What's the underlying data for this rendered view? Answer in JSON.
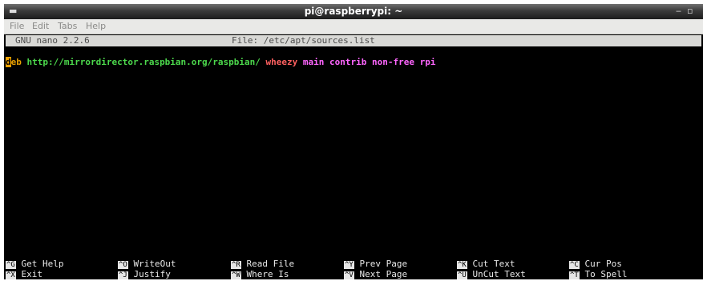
{
  "window": {
    "title": "pi@raspberrypi: ~"
  },
  "window_controls": {
    "minimize": "‒",
    "maximize": "▫"
  },
  "menubar": {
    "items": [
      "File",
      "Edit",
      "Tabs",
      "Help"
    ]
  },
  "nano": {
    "version": "GNU nano 2.2.6",
    "file_label": "File: /etc/apt/sources.list"
  },
  "editor": {
    "line1": {
      "cursor_char": "d",
      "deb_rest": "eb",
      "url": "http://mirrordirector.raspbian.org/raspbian/",
      "dist": "wheezy",
      "components": "main contrib non-free rpi"
    }
  },
  "shortcuts": [
    {
      "key": "^G",
      "label": "Get Help"
    },
    {
      "key": "^X",
      "label": "Exit"
    },
    {
      "key": "^O",
      "label": "WriteOut"
    },
    {
      "key": "^J",
      "label": "Justify"
    },
    {
      "key": "^R",
      "label": "Read File"
    },
    {
      "key": "^W",
      "label": "Where Is"
    },
    {
      "key": "^Y",
      "label": "Prev Page"
    },
    {
      "key": "^V",
      "label": "Next Page"
    },
    {
      "key": "^K",
      "label": "Cut Text"
    },
    {
      "key": "^U",
      "label": "UnCut Text"
    },
    {
      "key": "^C",
      "label": "Cur Pos"
    },
    {
      "key": "^T",
      "label": "To Spell"
    }
  ]
}
